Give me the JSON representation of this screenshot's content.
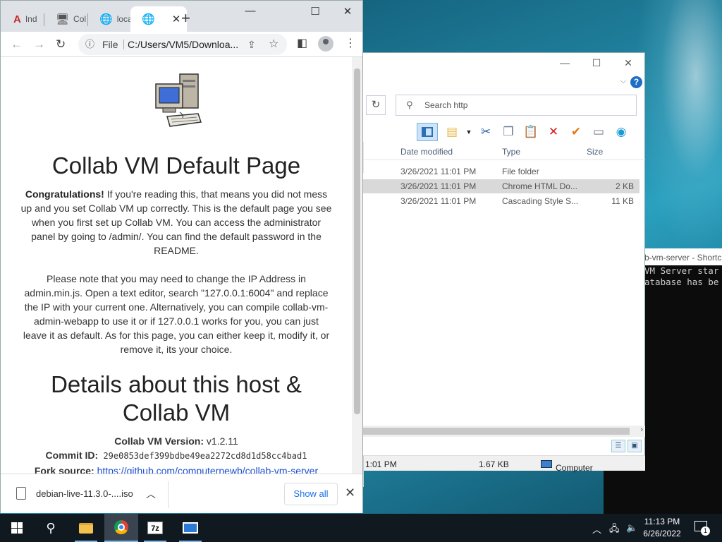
{
  "chrome": {
    "tabs": [
      {
        "label": "Ind",
        "icon": "letter-a-icon"
      },
      {
        "label": "Col",
        "icon": "computer-icon"
      },
      {
        "label": "loca",
        "icon": "globe-icon"
      },
      {
        "label": "",
        "icon": "globe-icon",
        "active": true
      }
    ],
    "new_tab_label": "+",
    "window_controls": {
      "minimize": "—",
      "maximize": "☐",
      "close": "✕"
    },
    "omnibox": {
      "scheme": "File",
      "url": "C:/Users/VM5/Downloa..."
    },
    "page": {
      "title": "Collab VM Default Page",
      "intro_bold": "Congratulations!",
      "intro_rest": " If you're reading this, that means you did not mess up and you set Collab VM up correctly. This is the default page you see when you first set up Collab VM. You can access the administrator panel by going to /admin/. You can find the default password in the README.",
      "note": "Please note that you may need to change the IP Address in admin.min.js. Open a text editor, search \"127.0.0.1:6004\" and replace the IP with your current one. Alternatively, you can compile collab-vm-admin-webapp to use it or if 127.0.0.1 works for you, you can just leave it as default. As for this page, you can either keep it, modify it, or remove it, its your choice.",
      "details_title": "Details about this host & Collab VM",
      "version_label": "Collab VM Version:",
      "version_value": " v1.2.11",
      "commit_label": "Commit ID:",
      "commit_value": " 29e0853def399bdbe49ea2272cd8d1d58cc4bad1",
      "fork_label": "Fork source:",
      "fork_value": "https://github.com/computernewb/collab-vm-server"
    },
    "download_bar": {
      "filename": "debian-live-11.3.0-....iso",
      "show_all": "Show all",
      "close": "✕"
    }
  },
  "explorer": {
    "search_placeholder": "Search http",
    "columns": [
      "Date modified",
      "Type",
      "Size"
    ],
    "rows": [
      {
        "date": "3/26/2021 11:01 PM",
        "type": "File folder",
        "size": ""
      },
      {
        "date": "3/26/2021 11:01 PM",
        "type": "Chrome HTML Do...",
        "size": "2 KB",
        "selected": true
      },
      {
        "date": "3/26/2021 11:01 PM",
        "type": "Cascading Style S...",
        "size": "11 KB"
      }
    ],
    "status": {
      "modified": "1:01 PM",
      "size": "1.67 KB",
      "location": "Computer"
    }
  },
  "console": {
    "title": "b-vm-server - Shortcu",
    "lines": [
      "VM Server star",
      "atabase has be"
    ]
  },
  "taskbar": {
    "apps": [
      "start-icon",
      "search-icon",
      "file-explorer-icon",
      "chrome-icon",
      "7zip-icon",
      "app-window-icon"
    ],
    "sevenzip_label": "7z",
    "clock_time": "11:13 PM",
    "clock_date": "6/26/2022",
    "notification_count": "1"
  },
  "colors": {
    "accent": "#1a73e8",
    "link": "#1a4fd0",
    "taskbar": "#101820"
  }
}
